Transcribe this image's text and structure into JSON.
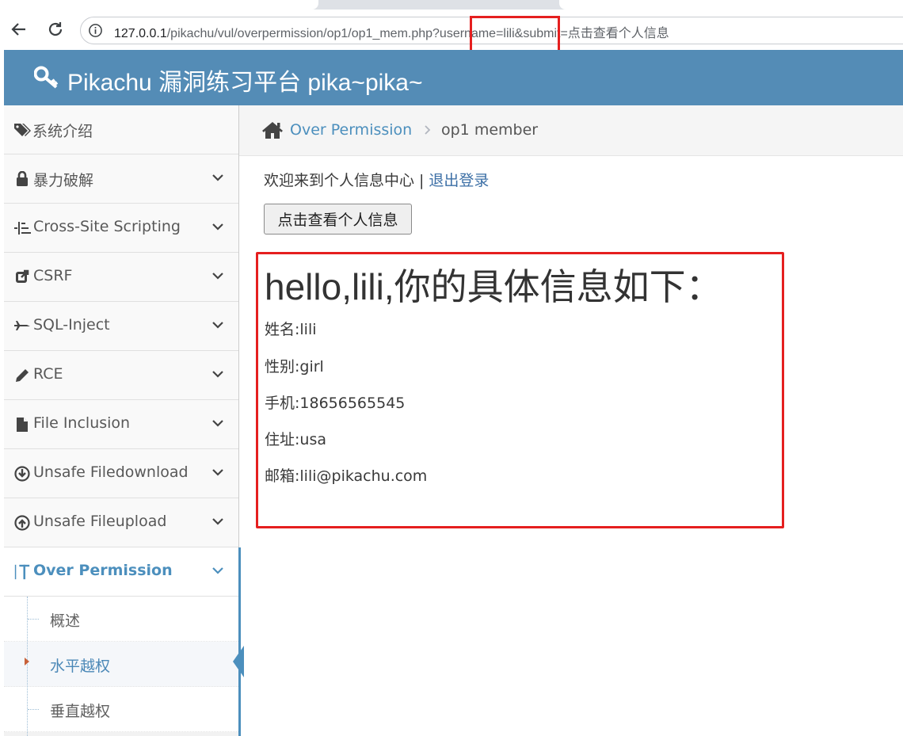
{
  "browser": {
    "url_host": "127.0.0.1",
    "url_path": "/pikachu/vul/overpermission/op1/op1_mem.php?username=lili&submit=点击查看个人信息"
  },
  "header": {
    "title": "Pikachu 漏洞练习平台 pika~pika~"
  },
  "sidebar": {
    "items": [
      {
        "label": "系统介绍",
        "icon": "tags-icon"
      },
      {
        "label": "暴力破解",
        "icon": "lock-icon"
      },
      {
        "label": "Cross-Site Scripting",
        "icon": "list-icon"
      },
      {
        "label": "CSRF",
        "icon": "share-icon"
      },
      {
        "label": "SQL-Inject",
        "icon": "plane-icon"
      },
      {
        "label": "RCE",
        "icon": "pencil-icon"
      },
      {
        "label": "File Inclusion",
        "icon": "file-icon"
      },
      {
        "label": "Unsafe Filedownload",
        "icon": "download-icon"
      },
      {
        "label": "Unsafe Fileupload",
        "icon": "upload-icon"
      },
      {
        "label": "Over Permission",
        "icon": "text-height-icon",
        "active": true
      }
    ],
    "subitems": [
      {
        "label": "概述"
      },
      {
        "label": "水平越权",
        "active": true
      },
      {
        "label": "垂直越权"
      }
    ]
  },
  "breadcrumb": {
    "link": "Over Permission",
    "current": "op1 member"
  },
  "main": {
    "welcome": "欢迎来到个人信息中心",
    "separator": "|",
    "logout": "退出登录",
    "button_label": "点击查看个人信息",
    "hello": "hello,lili,你的具体信息如下：",
    "fields": [
      "姓名:lili",
      "性别:girl",
      "手机:18656565545",
      "住址:usa",
      "邮箱:lili@pikachu.com"
    ]
  },
  "colors": {
    "header_bg": "#548cb6",
    "accent": "#4c8fbd",
    "highlight_red": "#e51f1f"
  }
}
